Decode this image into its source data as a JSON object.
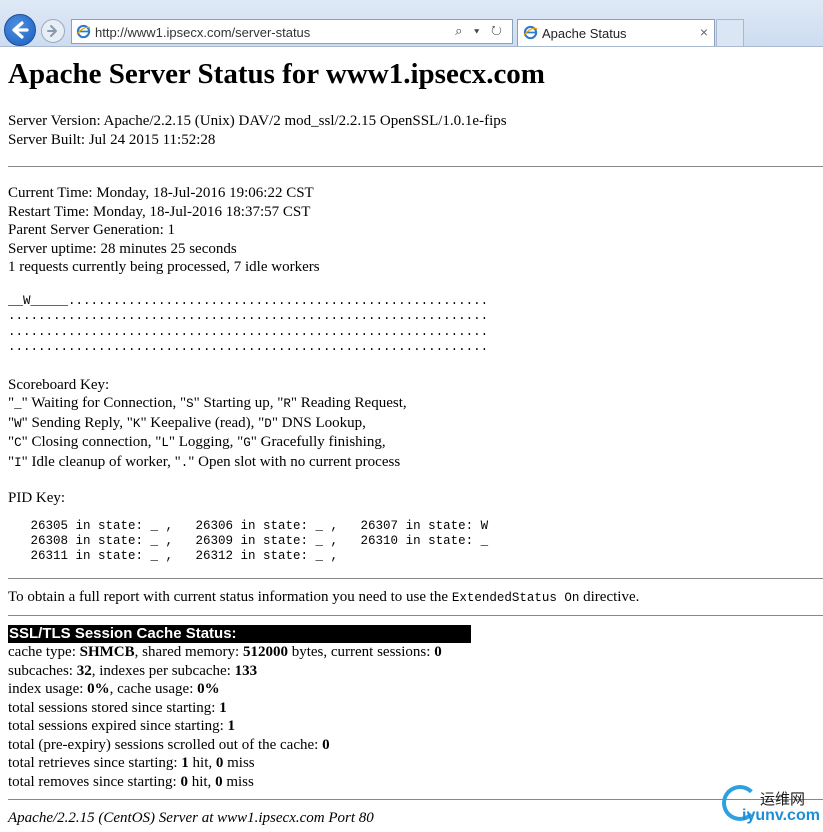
{
  "browser": {
    "url": "http://www1.ipsecx.com/server-status",
    "tab_title": "Apache Status",
    "tab_close": "×",
    "addr_controls": "⌕ ▾ ↻"
  },
  "page": {
    "title": "Apache Server Status for www1.ipsecx.com",
    "server_version": "Server Version: Apache/2.2.15 (Unix) DAV/2 mod_ssl/2.2.15 OpenSSL/1.0.1e-fips",
    "server_built": "Server Built: Jul 24 2015 11:52:28",
    "current_time": "Current Time: Monday, 18-Jul-2016 19:06:22 CST",
    "restart_time": "Restart Time: Monday, 18-Jul-2016 18:37:57 CST",
    "parent_generation": "Parent Server Generation: 1",
    "uptime": "Server uptime: 28 minutes 25 seconds",
    "requests": "1 requests currently being processed, 7 idle workers",
    "scoreboard": [
      "__W_____........................................................",
      "................................................................",
      "................................................................",
      "................................................................"
    ],
    "scoreboard_key_title": "Scoreboard Key:",
    "scoreboard_key": [
      [
        "\"",
        "_",
        "\" Waiting for Connection, \"",
        "S",
        "\" Starting up, \"",
        "R",
        "\" Reading Request,"
      ],
      [
        "\"",
        "W",
        "\" Sending Reply, \"",
        "K",
        "\" Keepalive (read), \"",
        "D",
        "\" DNS Lookup,"
      ],
      [
        "\"",
        "C",
        "\" Closing connection, \"",
        "L",
        "\" Logging, \"",
        "G",
        "\" Gracefully finishing,"
      ],
      [
        "\"",
        "I",
        "\" Idle cleanup of worker, \"",
        ".",
        "\" Open slot with no current process",
        "",
        ""
      ]
    ],
    "pid_key_title": "PID Key:",
    "pid_key": [
      "   26305 in state: _ ,   26306 in state: _ ,   26307 in state: W",
      "   26308 in state: _ ,   26309 in state: _ ,   26310 in state: _",
      "   26311 in state: _ ,   26312 in state: _ ,"
    ],
    "report_pre": "To obtain a full report with current status information you need to use the ",
    "report_code": "ExtendedStatus On",
    "report_post": " directive.",
    "ssl_title": "SSL/TLS Session Cache Status:",
    "ssl_lines": [
      [
        [
          "cache type: ",
          false
        ],
        [
          "SHMCB",
          true
        ],
        [
          ", shared memory: ",
          false
        ],
        [
          "512000",
          true
        ],
        [
          " bytes, current sessions: ",
          false
        ],
        [
          "0",
          true
        ]
      ],
      [
        [
          "subcaches: ",
          false
        ],
        [
          "32",
          true
        ],
        [
          ", indexes per subcache: ",
          false
        ],
        [
          "133",
          true
        ]
      ],
      [
        [
          "index usage: ",
          false
        ],
        [
          "0%",
          true
        ],
        [
          ", cache usage: ",
          false
        ],
        [
          "0%",
          true
        ]
      ],
      [
        [
          "total sessions stored since starting: ",
          false
        ],
        [
          "1",
          true
        ]
      ],
      [
        [
          "total sessions expired since starting: ",
          false
        ],
        [
          "1",
          true
        ]
      ],
      [
        [
          "total (pre-expiry) sessions scrolled out of the cache: ",
          false
        ],
        [
          "0",
          true
        ]
      ],
      [
        [
          "total retrieves since starting: ",
          false
        ],
        [
          "1",
          true
        ],
        [
          " hit, ",
          false
        ],
        [
          "0",
          true
        ],
        [
          " miss",
          false
        ]
      ],
      [
        [
          "total removes since starting: ",
          false
        ],
        [
          "0",
          true
        ],
        [
          " hit, ",
          false
        ],
        [
          "0",
          true
        ],
        [
          " miss",
          false
        ]
      ]
    ],
    "footer": "Apache/2.2.15 (CentOS) Server at www1.ipsecx.com Port 80"
  },
  "watermark": {
    "cn": "运维网",
    "en": "iyunv.com"
  }
}
